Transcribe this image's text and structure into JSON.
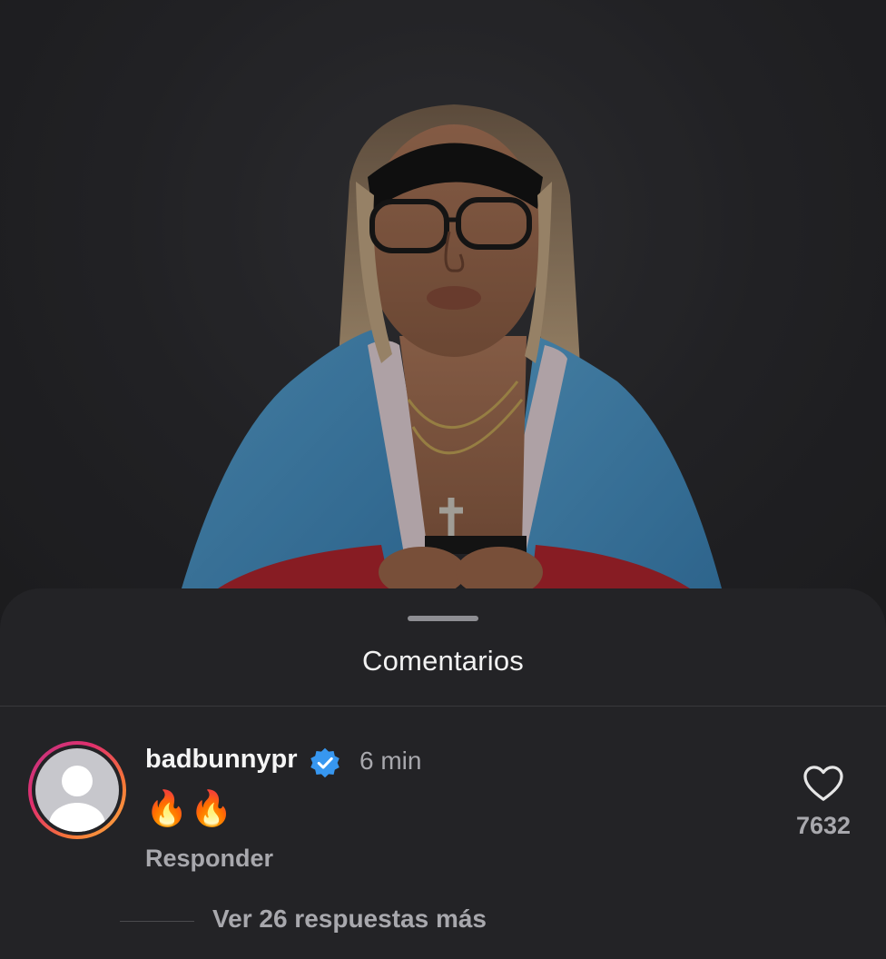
{
  "sheet": {
    "title": "Comentarios"
  },
  "comment": {
    "username": "badbunnypr",
    "verified_icon": "verified-badge-icon",
    "timestamp": "6 min",
    "text": "🔥🔥",
    "reply_label": "Responder",
    "like_icon": "heart-icon",
    "like_count": "7632",
    "view_replies_label": "Ver 26 respuestas más"
  },
  "colors": {
    "background": "#232326",
    "verified": "#3797f0",
    "secondary_text": "#a8a8ad",
    "primary_text": "#f5f5f5"
  }
}
